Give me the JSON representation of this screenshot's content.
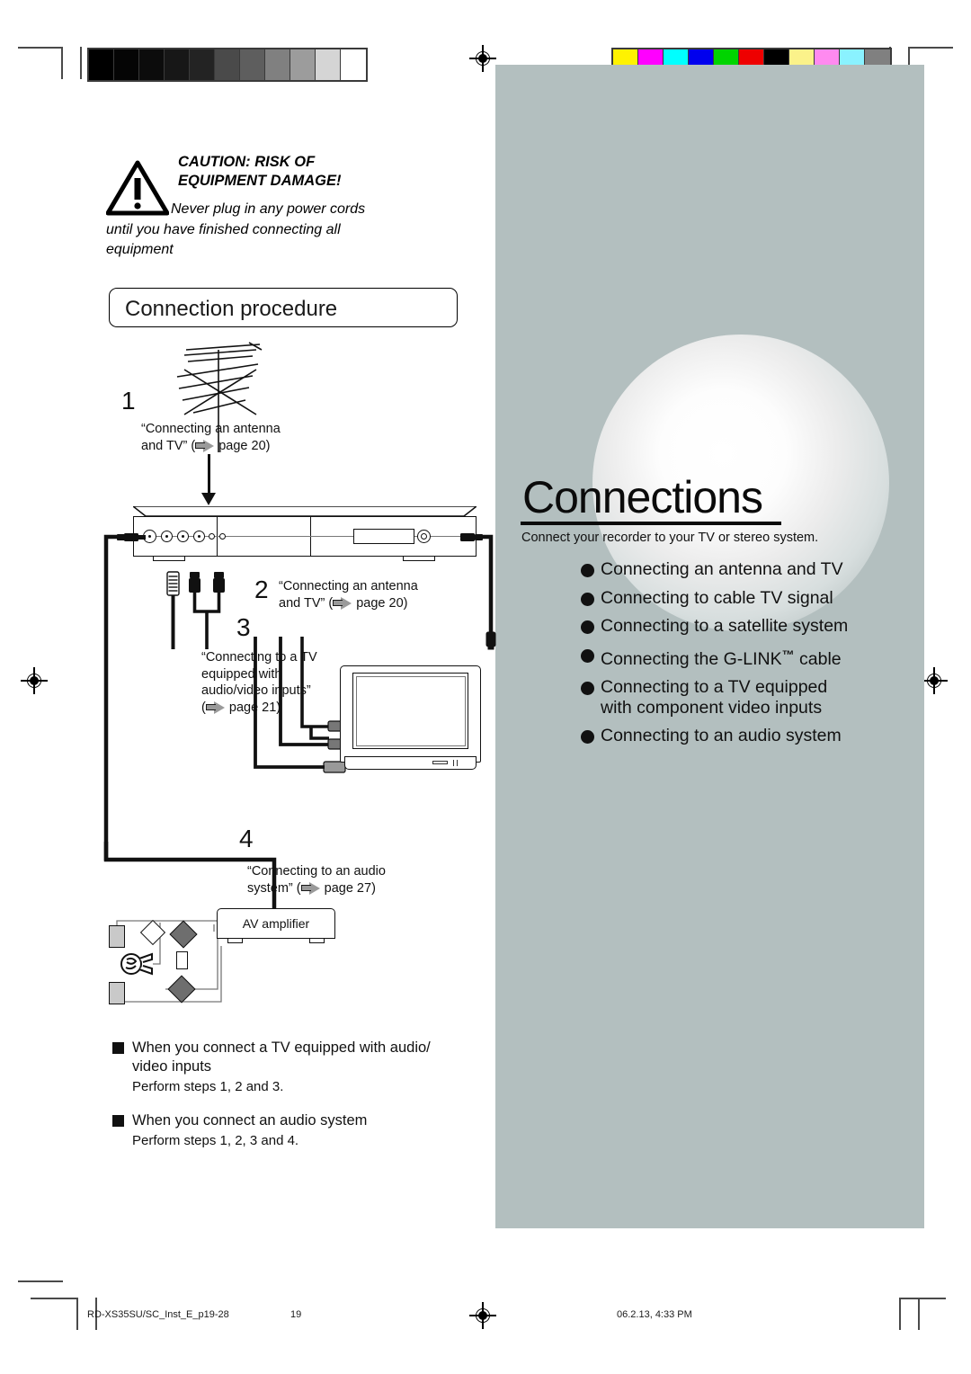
{
  "page": {
    "background": "#ffffff",
    "panel_color": "#b3bfbf"
  },
  "caution": {
    "heading_line1": "CAUTION: RISK OF",
    "heading_line2": "EQUIPMENT DAMAGE!",
    "body_line1": "Never plug in any power cords",
    "body_line2": "until you have finished connecting all",
    "body_line3": "equipment",
    "icon": "warning-triangle-icon"
  },
  "section": {
    "heading": "Connection procedure"
  },
  "panel": {
    "title": "Connections",
    "subtitle": "Connect your recorder to your TV or stereo system.",
    "items": [
      {
        "text": "Connecting an antenna and TV"
      },
      {
        "text": "Connecting to cable TV signal"
      },
      {
        "text": "Connecting to a satellite system"
      },
      {
        "text": "Connecting the G-LINK",
        "tm": "™",
        "text_after": "cable"
      },
      {
        "text": "Connecting to a TV equipped",
        "line2": "with component video inputs"
      },
      {
        "text": "Connecting to an audio system"
      }
    ]
  },
  "steps": [
    {
      "number": "1",
      "line1": "“Connecting an antenna",
      "line2_pre": "and TV” (",
      "page": "page 20",
      "line2_post": ")"
    },
    {
      "number": "2",
      "line1": "“Connecting an antenna",
      "line2_pre": "and TV” (",
      "page": "page 20",
      "line2_post": ")"
    },
    {
      "number": "3",
      "line1": "“Connecting to a TV",
      "line2": "equipped with",
      "line3": "audio/video inputs”",
      "line4_pre": "(",
      "page": "page 21",
      "line4_post": ")"
    },
    {
      "number": "4",
      "line1": "“Connecting to an audio",
      "line2_pre": "system” (",
      "page": "page 27",
      "line2_post": ")"
    }
  ],
  "diagram": {
    "av_amplifier_label": "AV amplifier"
  },
  "notes": [
    {
      "heading_l1": "When you connect a TV equipped with audio/",
      "heading_l2": "video inputs",
      "body": "Perform steps 1, 2 and 3."
    },
    {
      "heading_l1": "When you connect an audio system",
      "heading_l2": "",
      "body": "Perform steps 1, 2, 3 and 4."
    }
  ],
  "footer": {
    "filename": "RD-XS35SU/SC_Inst_E_p19-28",
    "page_number": "19",
    "timestamp": "06.2.13, 4:33 PM"
  },
  "calibration": {
    "grayscale": [
      "#000000",
      "#050505",
      "#0c0c0c",
      "#171717",
      "#232323",
      "#4a4a4a",
      "#5e5e5e",
      "#808080",
      "#9c9c9c",
      "#d5d5d5",
      "#ffffff"
    ],
    "colorbars": [
      "#fff200",
      "#ff00ff",
      "#00ffff",
      "#0000ee",
      "#00d400",
      "#ee0000",
      "#000000",
      "#fbf28a",
      "#ff8af0",
      "#8af2ff",
      "#808080"
    ]
  }
}
